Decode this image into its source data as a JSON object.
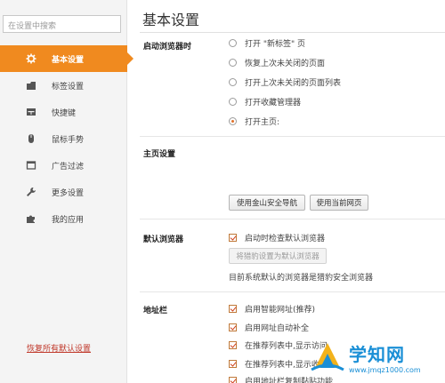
{
  "sidebar": {
    "search_placeholder": "在设置中搜索",
    "items": [
      {
        "label": "基本设置",
        "icon": "gear-icon",
        "active": true
      },
      {
        "label": "标签设置",
        "icon": "tab-icon"
      },
      {
        "label": "快捷键",
        "icon": "keyboard-icon"
      },
      {
        "label": "鼠标手势",
        "icon": "mouse-icon"
      },
      {
        "label": "广告过滤",
        "icon": "window-icon"
      },
      {
        "label": "更多设置",
        "icon": "wrench-icon"
      },
      {
        "label": "我的应用",
        "icon": "puzzle-icon"
      }
    ],
    "restore_link": "恢复所有默认设置"
  },
  "main": {
    "title": "基本设置",
    "startup": {
      "label": "启动浏览器时",
      "options": [
        {
          "label": "打开 \"新标签\" 页",
          "checked": false
        },
        {
          "label": "恢复上次未关闭的页面",
          "checked": false
        },
        {
          "label": "打开上次未关闭的页面列表",
          "checked": false
        },
        {
          "label": "打开收藏管理器",
          "checked": false
        },
        {
          "label": "打开主页:",
          "checked": true
        }
      ]
    },
    "homepage": {
      "label": "主页设置",
      "btn_nav": "使用金山安全导航",
      "btn_current": "使用当前网页"
    },
    "default_browser": {
      "label": "默认浏览器",
      "check_label": "启动时检查默认浏览器",
      "checked": true,
      "btn_set_default": "将猎豹设置为默认浏览器",
      "note": "目前系统默认的浏览器是猎豹安全浏览器"
    },
    "address_bar": {
      "label": "地址栏",
      "options": [
        {
          "label": "启用智能网址(推荐)",
          "checked": true
        },
        {
          "label": "启用网址自动补全",
          "checked": true
        },
        {
          "label": "在推荐列表中,显示访问",
          "checked": true
        },
        {
          "label": "在推荐列表中,显示收",
          "checked": true
        },
        {
          "label": "启用地址栏复制黏贴功能",
          "checked": true
        }
      ]
    }
  },
  "watermark": {
    "name": "学知网",
    "url": "www.jmqz1000.com"
  },
  "colors": {
    "accent": "#f08a1f",
    "watermark_blue": "#1a8fd6"
  }
}
